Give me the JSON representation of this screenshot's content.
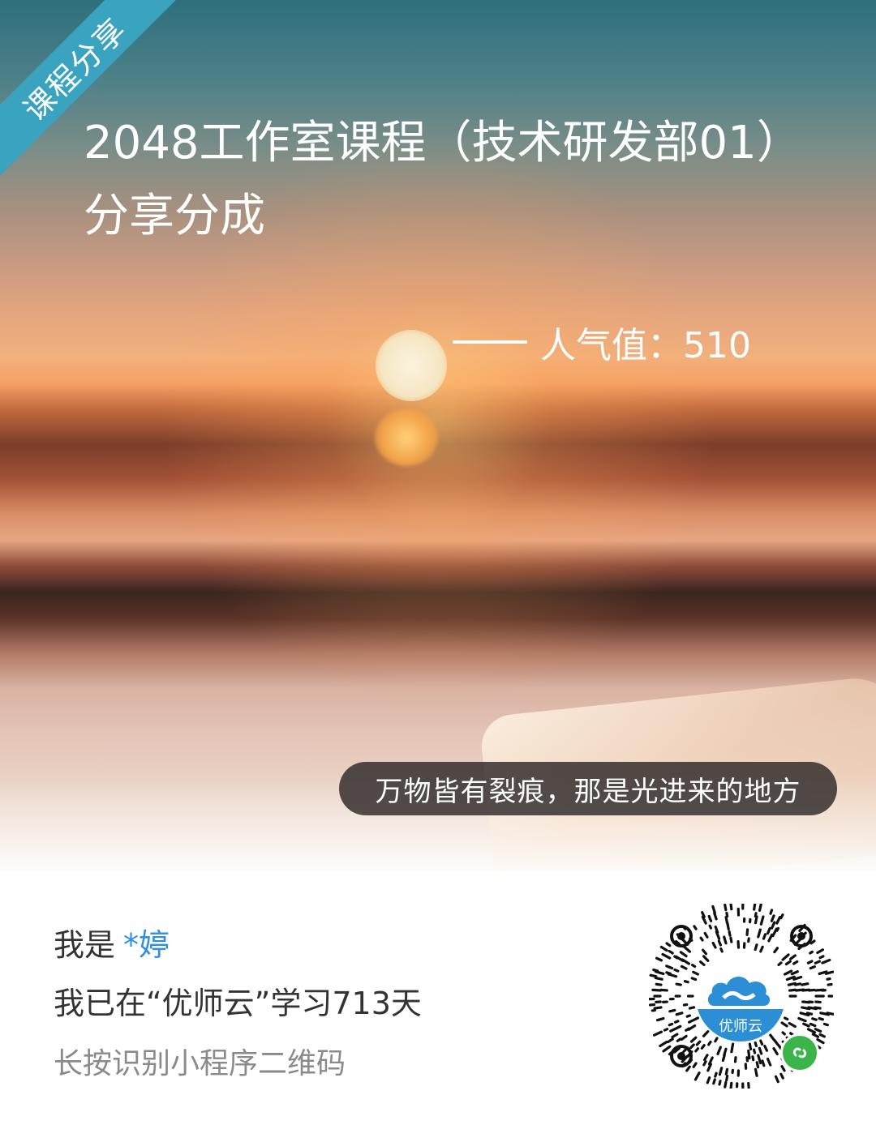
{
  "ribbon": {
    "label": "课程分享"
  },
  "poster": {
    "title": "2048工作室课程（技术研发部01）分享分成",
    "popularity": "人气值：510",
    "quote": "万物皆有裂痕，那是光进来的地方"
  },
  "footer": {
    "greeting_prefix": "我是",
    "user_name": "*婷",
    "study_days": "我已在“优师云”学习713天",
    "hint": "长按识别小程序二维码",
    "qr_logo_text": "优师云"
  },
  "colors": {
    "ribbon": "#3aa3bf",
    "name_accent": "#2f8fe8",
    "qr_logo_band": "#2c8fd6",
    "wechat_green": "#3bb44a"
  },
  "icons": {
    "qr": "qr-code-icon",
    "logo": "cloud-logo-icon",
    "badge": "mini-program-icon"
  }
}
